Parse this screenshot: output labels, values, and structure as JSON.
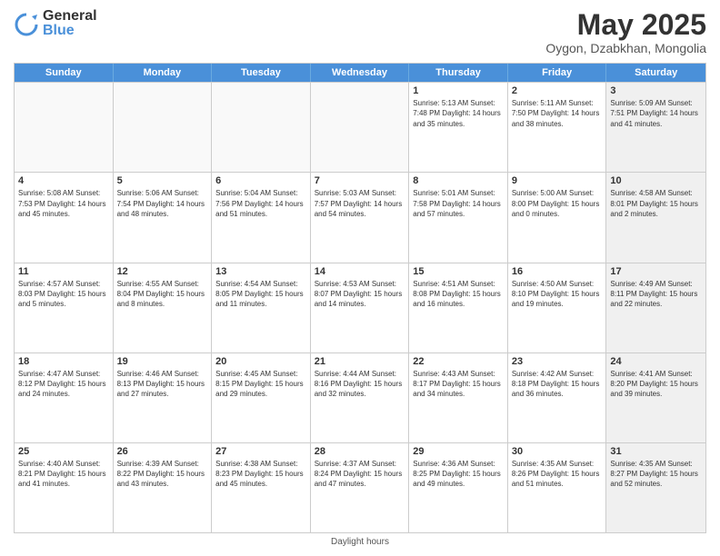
{
  "header": {
    "logo_general": "General",
    "logo_blue": "Blue",
    "main_title": "May 2025",
    "subtitle": "Oygon, Dzabkhan, Mongolia"
  },
  "days_of_week": [
    "Sunday",
    "Monday",
    "Tuesday",
    "Wednesday",
    "Thursday",
    "Friday",
    "Saturday"
  ],
  "footer_note": "Daylight hours",
  "weeks": [
    [
      {
        "day": "",
        "content": "",
        "empty": true
      },
      {
        "day": "",
        "content": "",
        "empty": true
      },
      {
        "day": "",
        "content": "",
        "empty": true
      },
      {
        "day": "",
        "content": "",
        "empty": true
      },
      {
        "day": "1",
        "content": "Sunrise: 5:13 AM\nSunset: 7:48 PM\nDaylight: 14 hours\nand 35 minutes.",
        "empty": false
      },
      {
        "day": "2",
        "content": "Sunrise: 5:11 AM\nSunset: 7:50 PM\nDaylight: 14 hours\nand 38 minutes.",
        "empty": false
      },
      {
        "day": "3",
        "content": "Sunrise: 5:09 AM\nSunset: 7:51 PM\nDaylight: 14 hours\nand 41 minutes.",
        "empty": false,
        "shaded": true
      }
    ],
    [
      {
        "day": "4",
        "content": "Sunrise: 5:08 AM\nSunset: 7:53 PM\nDaylight: 14 hours\nand 45 minutes.",
        "empty": false
      },
      {
        "day": "5",
        "content": "Sunrise: 5:06 AM\nSunset: 7:54 PM\nDaylight: 14 hours\nand 48 minutes.",
        "empty": false
      },
      {
        "day": "6",
        "content": "Sunrise: 5:04 AM\nSunset: 7:56 PM\nDaylight: 14 hours\nand 51 minutes.",
        "empty": false
      },
      {
        "day": "7",
        "content": "Sunrise: 5:03 AM\nSunset: 7:57 PM\nDaylight: 14 hours\nand 54 minutes.",
        "empty": false
      },
      {
        "day": "8",
        "content": "Sunrise: 5:01 AM\nSunset: 7:58 PM\nDaylight: 14 hours\nand 57 minutes.",
        "empty": false
      },
      {
        "day": "9",
        "content": "Sunrise: 5:00 AM\nSunset: 8:00 PM\nDaylight: 15 hours\nand 0 minutes.",
        "empty": false
      },
      {
        "day": "10",
        "content": "Sunrise: 4:58 AM\nSunset: 8:01 PM\nDaylight: 15 hours\nand 2 minutes.",
        "empty": false,
        "shaded": true
      }
    ],
    [
      {
        "day": "11",
        "content": "Sunrise: 4:57 AM\nSunset: 8:03 PM\nDaylight: 15 hours\nand 5 minutes.",
        "empty": false
      },
      {
        "day": "12",
        "content": "Sunrise: 4:55 AM\nSunset: 8:04 PM\nDaylight: 15 hours\nand 8 minutes.",
        "empty": false
      },
      {
        "day": "13",
        "content": "Sunrise: 4:54 AM\nSunset: 8:05 PM\nDaylight: 15 hours\nand 11 minutes.",
        "empty": false
      },
      {
        "day": "14",
        "content": "Sunrise: 4:53 AM\nSunset: 8:07 PM\nDaylight: 15 hours\nand 14 minutes.",
        "empty": false
      },
      {
        "day": "15",
        "content": "Sunrise: 4:51 AM\nSunset: 8:08 PM\nDaylight: 15 hours\nand 16 minutes.",
        "empty": false
      },
      {
        "day": "16",
        "content": "Sunrise: 4:50 AM\nSunset: 8:10 PM\nDaylight: 15 hours\nand 19 minutes.",
        "empty": false
      },
      {
        "day": "17",
        "content": "Sunrise: 4:49 AM\nSunset: 8:11 PM\nDaylight: 15 hours\nand 22 minutes.",
        "empty": false,
        "shaded": true
      }
    ],
    [
      {
        "day": "18",
        "content": "Sunrise: 4:47 AM\nSunset: 8:12 PM\nDaylight: 15 hours\nand 24 minutes.",
        "empty": false
      },
      {
        "day": "19",
        "content": "Sunrise: 4:46 AM\nSunset: 8:13 PM\nDaylight: 15 hours\nand 27 minutes.",
        "empty": false
      },
      {
        "day": "20",
        "content": "Sunrise: 4:45 AM\nSunset: 8:15 PM\nDaylight: 15 hours\nand 29 minutes.",
        "empty": false
      },
      {
        "day": "21",
        "content": "Sunrise: 4:44 AM\nSunset: 8:16 PM\nDaylight: 15 hours\nand 32 minutes.",
        "empty": false
      },
      {
        "day": "22",
        "content": "Sunrise: 4:43 AM\nSunset: 8:17 PM\nDaylight: 15 hours\nand 34 minutes.",
        "empty": false
      },
      {
        "day": "23",
        "content": "Sunrise: 4:42 AM\nSunset: 8:18 PM\nDaylight: 15 hours\nand 36 minutes.",
        "empty": false
      },
      {
        "day": "24",
        "content": "Sunrise: 4:41 AM\nSunset: 8:20 PM\nDaylight: 15 hours\nand 39 minutes.",
        "empty": false,
        "shaded": true
      }
    ],
    [
      {
        "day": "25",
        "content": "Sunrise: 4:40 AM\nSunset: 8:21 PM\nDaylight: 15 hours\nand 41 minutes.",
        "empty": false
      },
      {
        "day": "26",
        "content": "Sunrise: 4:39 AM\nSunset: 8:22 PM\nDaylight: 15 hours\nand 43 minutes.",
        "empty": false
      },
      {
        "day": "27",
        "content": "Sunrise: 4:38 AM\nSunset: 8:23 PM\nDaylight: 15 hours\nand 45 minutes.",
        "empty": false
      },
      {
        "day": "28",
        "content": "Sunrise: 4:37 AM\nSunset: 8:24 PM\nDaylight: 15 hours\nand 47 minutes.",
        "empty": false
      },
      {
        "day": "29",
        "content": "Sunrise: 4:36 AM\nSunset: 8:25 PM\nDaylight: 15 hours\nand 49 minutes.",
        "empty": false
      },
      {
        "day": "30",
        "content": "Sunrise: 4:35 AM\nSunset: 8:26 PM\nDaylight: 15 hours\nand 51 minutes.",
        "empty": false
      },
      {
        "day": "31",
        "content": "Sunrise: 4:35 AM\nSunset: 8:27 PM\nDaylight: 15 hours\nand 52 minutes.",
        "empty": false,
        "shaded": true
      }
    ]
  ]
}
